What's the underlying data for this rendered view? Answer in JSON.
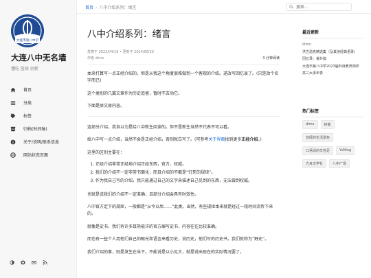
{
  "site": {
    "title": "大连八中无名墙",
    "subtitle": "懂吃 篮球 创新",
    "logo_text": "大连市第八中学"
  },
  "nav": [
    {
      "icon": "home-icon",
      "label": "首页"
    },
    {
      "icon": "menu-icon",
      "label": "分类"
    },
    {
      "icon": "tag-icon",
      "label": "标签"
    },
    {
      "icon": "archive-icon",
      "label": "归档(时间轴)"
    },
    {
      "icon": "info-icon",
      "label": "关于/说明/联系信息"
    },
    {
      "icon": "globe-icon",
      "label": "网站状态页面"
    }
  ],
  "bottom_icons": [
    "theme-toggle-icon",
    "github-icon",
    "mail-icon",
    "rss-icon"
  ],
  "header": {
    "breadcrumb_home": "首页",
    "breadcrumb_sep": "›",
    "breadcrumb_current": "八中介绍系列：绪言",
    "search_placeholder": "搜索..."
  },
  "post": {
    "title": "八中介绍系列：绪言",
    "published": "发表于 2023/04/16",
    "meta_sep": " • ",
    "updated": "更新于 2024/06/29",
    "author": "作者 dimo",
    "read_time": "3 分钟阅读",
    "p1": "本来打算写一点正经介绍的，但是从我这个角度很难做到一个客观的介绍。遂改写回忆录了。(只是改个名字而已)",
    "p2": "这个类别的几篇文章作为历史追留，暂时不去动它。",
    "p3": "下面是原文原内容。",
    "p4": "这部分介绍，我自以为是给八中新生阅读的。但不是新生当然不代表不可以看。",
    "p5_a": "给八中写一点介绍，当然不会是正经介绍，否则就白写了。(可参考",
    "p5_link": "关于界面",
    "p5_b": "找到更多",
    "p5_bold": "正经介绍",
    "p5_c": "。)",
    "p6": "这里的区别主要在：",
    "list": [
      "正经介绍非常正经地介绍正经东西，官方、权威。",
      "我们的介绍不一定非常书面化，而且介绍的不都是“钉死的规矩”。",
      "作为我自己写的介绍，我只能通过自己的文字来描述自己见到的东西，无法做到权威。"
    ],
    "p7": "也就是说我们的介绍不一定准确，且部分介绍会具有时效性。",
    "p8": "八中官方定下的规矩，一般都是“从今以后……”此类。当然，有些规矩本来就是经过一段时间流传下来的。",
    "p9": "就像是史书，我们有许多耳熟能详的官方编写史书，内容往往比较准确。",
    "p10": "而也有一些个人用他们自己的眼光和语言来看历史，说历史，他们写的历史书，我们就称为“野史”。",
    "p11": "我们介绍的事，则是发生在当下。不能说是以小见大，就是说出现在的实际情况罢了。"
  },
  "right": {
    "recent_title": "最近更新",
    "recent": [
      "dimo",
      "洪古遗老精选集（及其他经典语录）",
      "回忆录：番外篇",
      "大连市第八中学2023届科目教师测评",
      "高三大事年表"
    ],
    "tags_title": "热门标签",
    "tags": [
      "dimo",
      "转载",
      "曾经的生活景色",
      "口语话的辛苦足",
      "YuNing",
      "方舟文学社",
      "八中广场"
    ]
  }
}
